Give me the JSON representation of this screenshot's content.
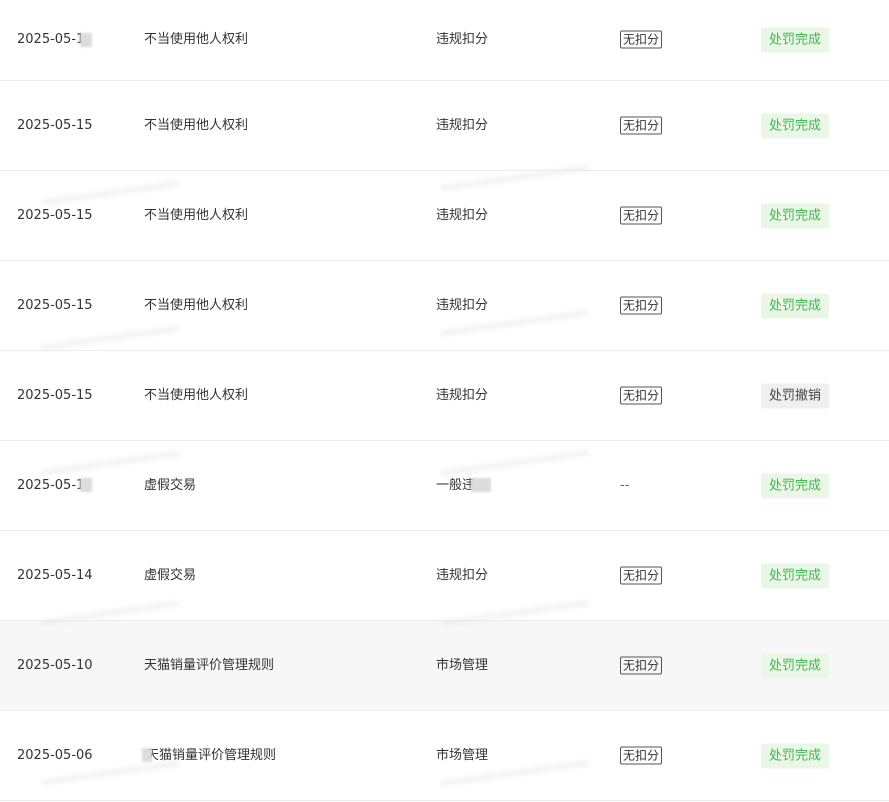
{
  "rows": [
    {
      "date": "2025-05-1",
      "reason": "不当使用他人权利",
      "type": "违规扣分",
      "deduct": "无扣分",
      "status": "处罚完成",
      "status_kind": "ok"
    },
    {
      "date": "2025-05-15",
      "reason": "不当使用他人权利",
      "type": "违规扣分",
      "deduct": "无扣分",
      "status": "处罚完成",
      "status_kind": "ok"
    },
    {
      "date": "2025-05-15",
      "reason": "不当使用他人权利",
      "type": "违规扣分",
      "deduct": "无扣分",
      "status": "处罚完成",
      "status_kind": "ok"
    },
    {
      "date": "2025-05-15",
      "reason": "不当使用他人权利",
      "type": "违规扣分",
      "deduct": "无扣分",
      "status": "处罚完成",
      "status_kind": "ok"
    },
    {
      "date": "2025-05-15",
      "reason": "不当使用他人权利",
      "type": "违规扣分",
      "deduct": "无扣分",
      "status": "处罚撤销",
      "status_kind": "revoked"
    },
    {
      "date": "2025-05-1",
      "reason": "虚假交易",
      "type": "一般违",
      "deduct": "--",
      "status": "处罚完成",
      "status_kind": "ok"
    },
    {
      "date": "2025-05-14",
      "reason": "虚假交易",
      "type": "违规扣分",
      "deduct": "无扣分",
      "status": "处罚完成",
      "status_kind": "ok"
    },
    {
      "date": "2025-05-10",
      "reason": "天猫销量评价管理规则",
      "type": "市场管理",
      "deduct": "无扣分",
      "status": "处罚完成",
      "status_kind": "ok"
    },
    {
      "date": "2025-05-06",
      "reason": "天猫销量评价管理规则",
      "type": "市场管理",
      "deduct": "无扣分",
      "status": "处罚完成",
      "status_kind": "ok"
    }
  ],
  "colors": {
    "status_ok_bg": "#eaf7e7",
    "status_ok_text": "#3fb650",
    "status_revoked_bg": "#f0f0f0",
    "row_hover_bg": "#f7f7f7",
    "divider": "#ececec"
  }
}
